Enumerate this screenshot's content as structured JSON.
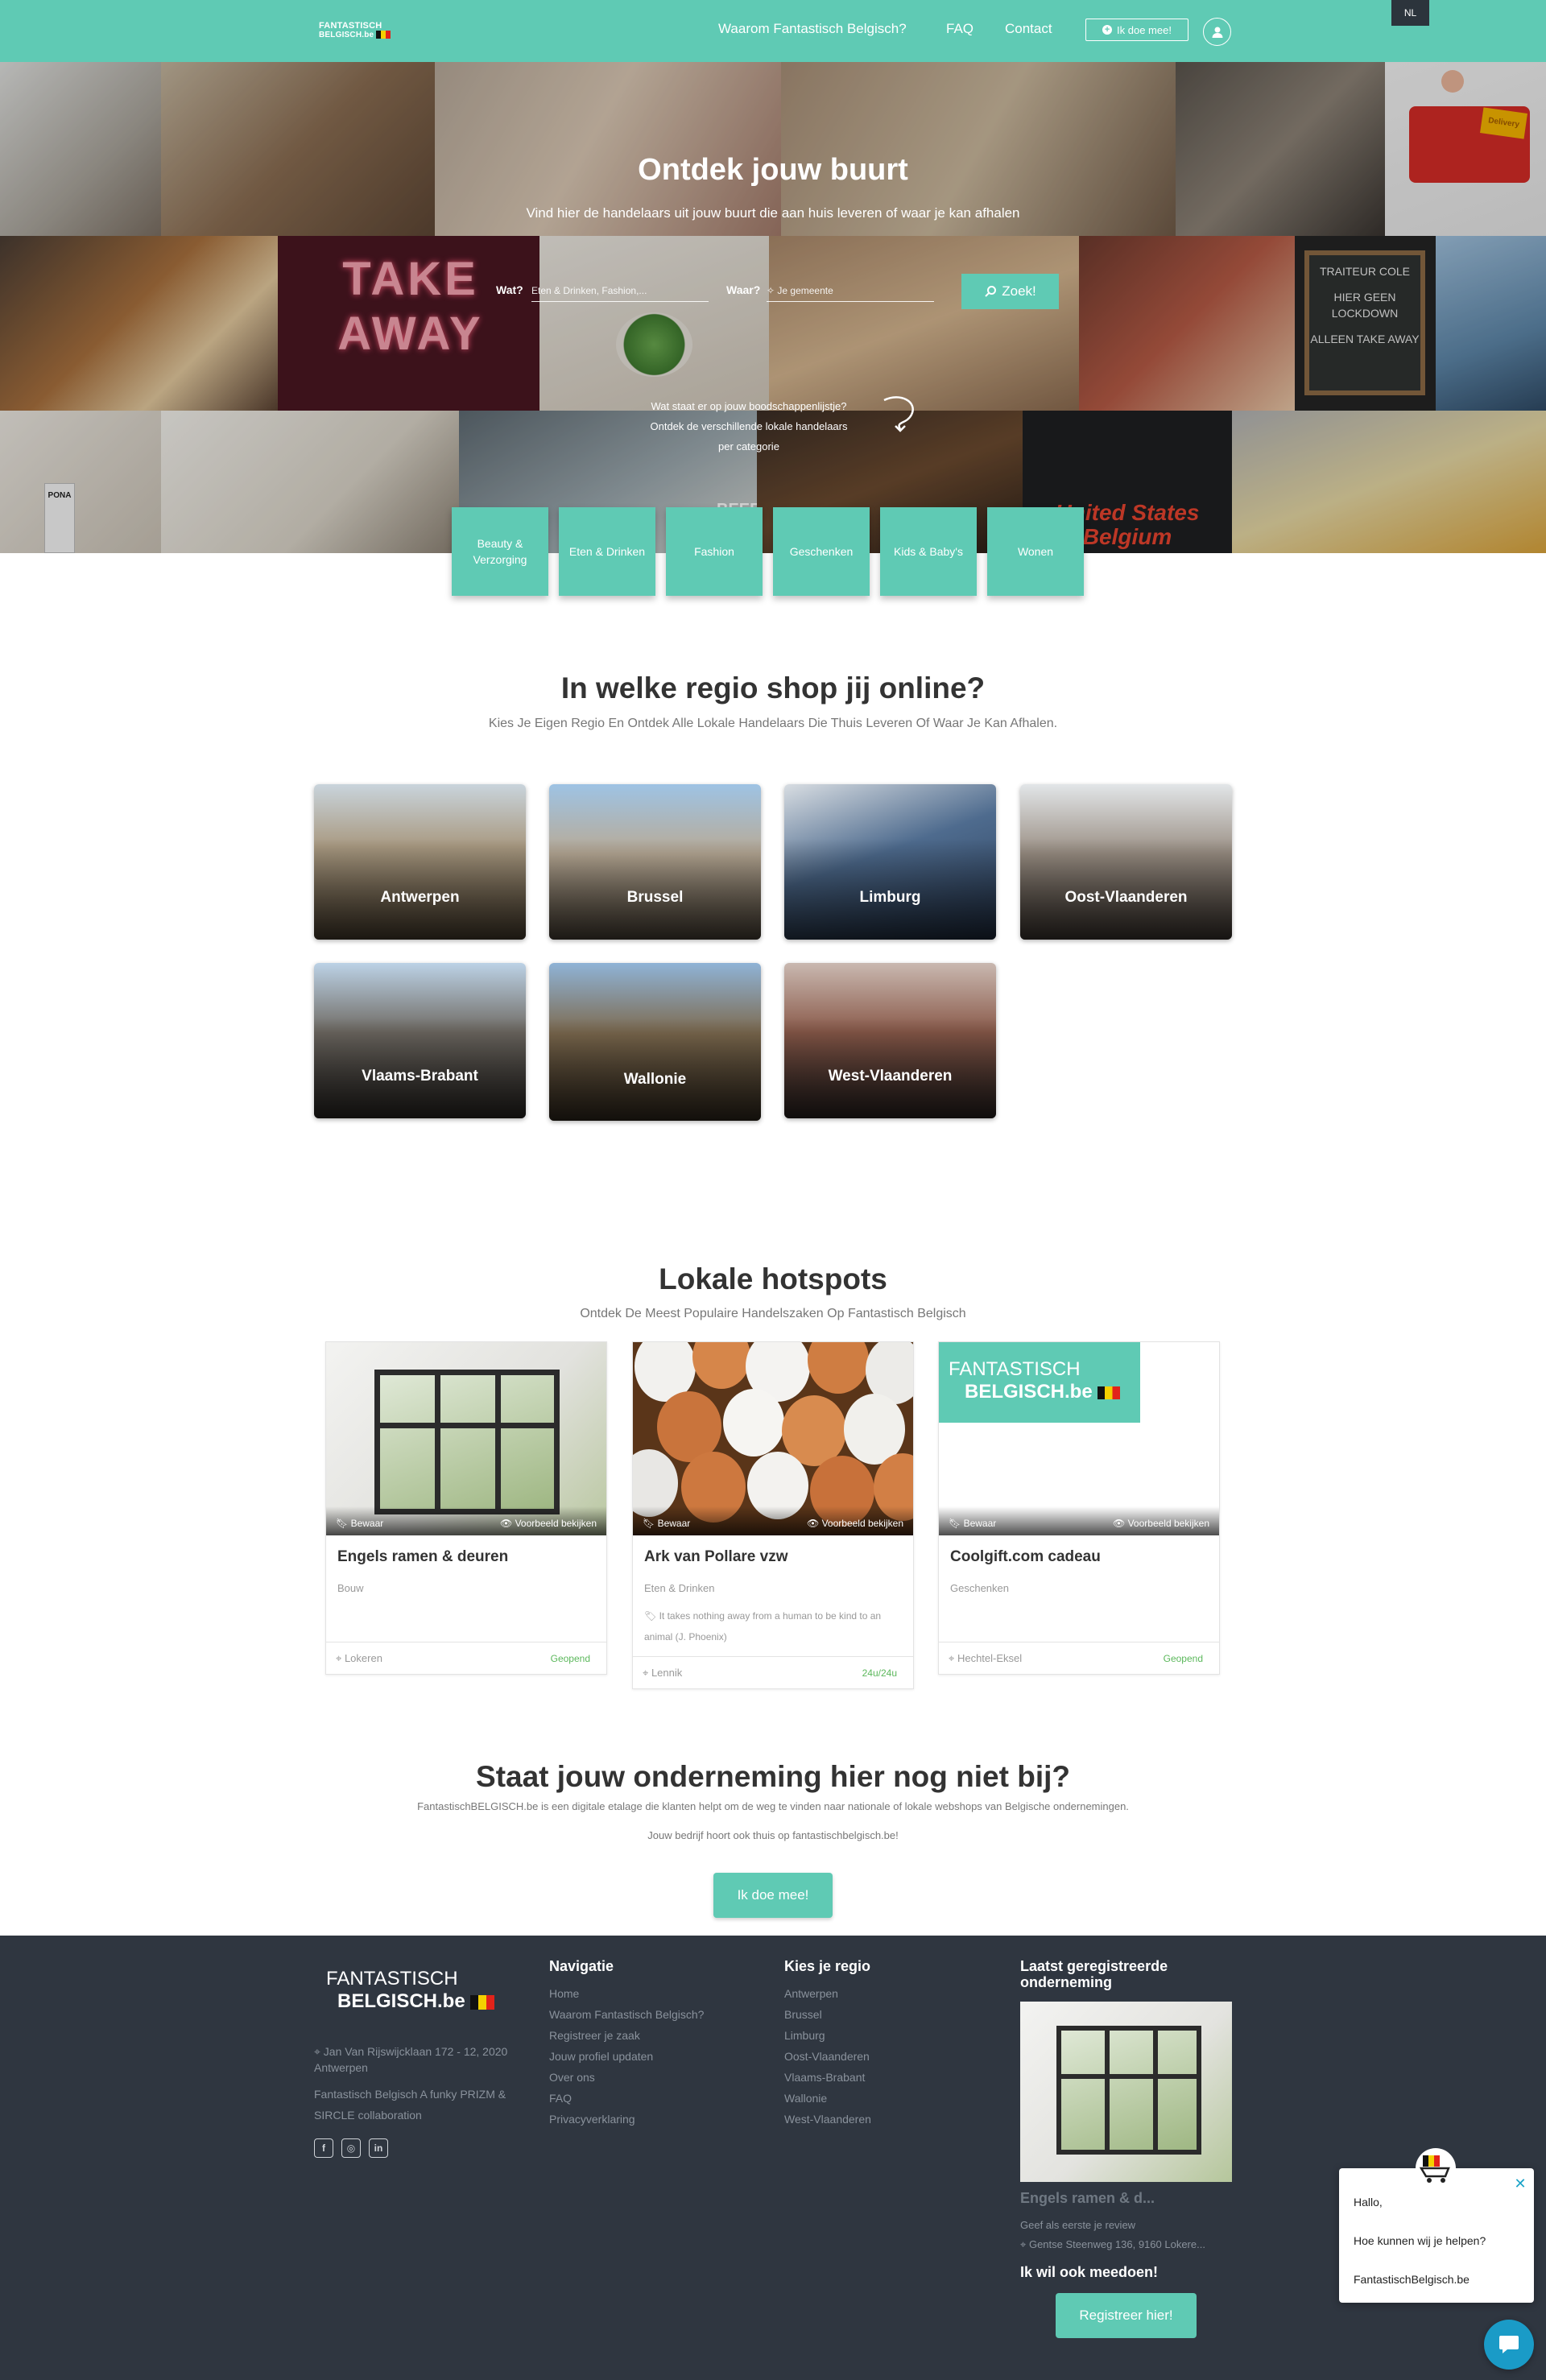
{
  "nav": {
    "logo_line1": "FANTASTISCH",
    "logo_line2": "BELGISCH.be",
    "links": [
      "Waarom Fantastisch Belgisch?",
      "FAQ",
      "Contact"
    ],
    "join_label": "Ik doe mee!",
    "language": "NL",
    "user_icon": "user-icon"
  },
  "hero": {
    "title": "Ontdek jouw buurt",
    "subtitle": "Vind hier de handelaars uit jouw buurt die aan huis leveren of waar je kan afhalen",
    "search": {
      "what_label": "Wat?",
      "what_placeholder": "Eten & Drinken, Fashion,...",
      "where_label": "Waar?",
      "where_placeholder": "Je gemeente",
      "button_label": "Zoek!"
    },
    "hint_lines": [
      "Wat staat er op jouw boodschappenlijstje?",
      "Ontdek de verschillende lokale handelaars",
      "per categorie"
    ],
    "categories": [
      "Beauty & Verzorging",
      "Eten & Drinken",
      "Fashion",
      "Geschenken",
      "Kids & Baby's",
      "Wonen"
    ],
    "tile_texts": {
      "take_away": "TAKE AWAY",
      "chalk_1": "TRAITEUR COLE",
      "chalk_2": "HIER GEEN LOCKDOWN",
      "chalk_3": "ALLEEN TAKE AWAY",
      "shirt": "United States Belgium",
      "delivery": "Delivery",
      "beer": "BEER",
      "pona": "PONA"
    }
  },
  "regions": {
    "title": "In welke regio shop jij online?",
    "subtitle": "Kies Je Eigen Regio En Ontdek Alle Lokale Handelaars Die Thuis Leveren Of Waar Je Kan Afhalen.",
    "items": [
      "Antwerpen",
      "Brussel",
      "Limburg",
      "Oost-Vlaanderen",
      "Vlaams-Brabant",
      "Wallonie",
      "West-Vlaanderen"
    ]
  },
  "hotspots": {
    "title": "Lokale hotspots",
    "subtitle": "Ontdek De Meest Populaire Handelszaken Op Fantastisch Belgisch",
    "save_label": "Bewaar",
    "preview_label": "Voorbeeld bekijken",
    "cards": [
      {
        "title": "Engels ramen & deuren",
        "category": "Bouw",
        "description": "",
        "location": "Lokeren",
        "status": "Geopend"
      },
      {
        "title": "Ark van Pollare vzw",
        "category": "Eten & Drinken",
        "description": "It takes nothing away from a human to be kind to an animal (J. Phoenix)",
        "location": "Lennik",
        "status": "24u/24u"
      },
      {
        "title": "Coolgift.com cadeau",
        "category": "Geschenken",
        "description": "",
        "location": "Hechtel-Eksel",
        "status": "Geopend"
      }
    ]
  },
  "cta": {
    "title": "Staat jouw onderneming hier nog niet bij?",
    "text1": "FantastischBELGISCH.be is een digitale etalage die klanten helpt om de weg te vinden naar nationale of lokale webshops van Belgische ondernemingen.",
    "text2": "Jouw bedrijf hoort ook thuis op fantastischbelgisch.be!",
    "button_label": "Ik doe mee!"
  },
  "footer": {
    "logo_line1": "FANTASTISCH",
    "logo_line2": "BELGISCH.be",
    "address": "Jan Van Rijswijcklaan 172 - 12, 2020 Antwerpen",
    "collab": "Fantastisch Belgisch A funky PRIZM & SIRCLE collaboration",
    "social_icons": [
      "facebook-icon",
      "instagram-icon",
      "linkedin-icon"
    ],
    "nav_title": "Navigatie",
    "nav_links": [
      "Home",
      "Waarom Fantastisch Belgisch?",
      "Registreer je zaak",
      "Jouw profiel updaten",
      "Over ons",
      "FAQ",
      "Privacyverklaring"
    ],
    "region_title": "Kies je regio",
    "region_links": [
      "Antwerpen",
      "Brussel",
      "Limburg",
      "Oost-Vlaanderen",
      "Vlaams-Brabant",
      "Wallonie",
      "West-Vlaanderen"
    ],
    "latest_title": "Laatst geregistreerde onderneming",
    "latest_name": "Engels ramen & d...",
    "latest_review": "Geef als eerste je review",
    "latest_address": "Gentse Steenweg 136, 9160 Lokere...",
    "join_title": "Ik wil ook meedoen!",
    "register_label": "Registreer hier!"
  },
  "chat": {
    "greeting": "Hallo,",
    "question": "Hoe kunnen wij je helpen?",
    "brand": "FantastischBelgisch.be"
  },
  "colors": {
    "accent": "#5fcab4",
    "footer_bg": "#2f3640",
    "status_green": "#5cb85c",
    "chat_blue": "#1a9bc7"
  }
}
